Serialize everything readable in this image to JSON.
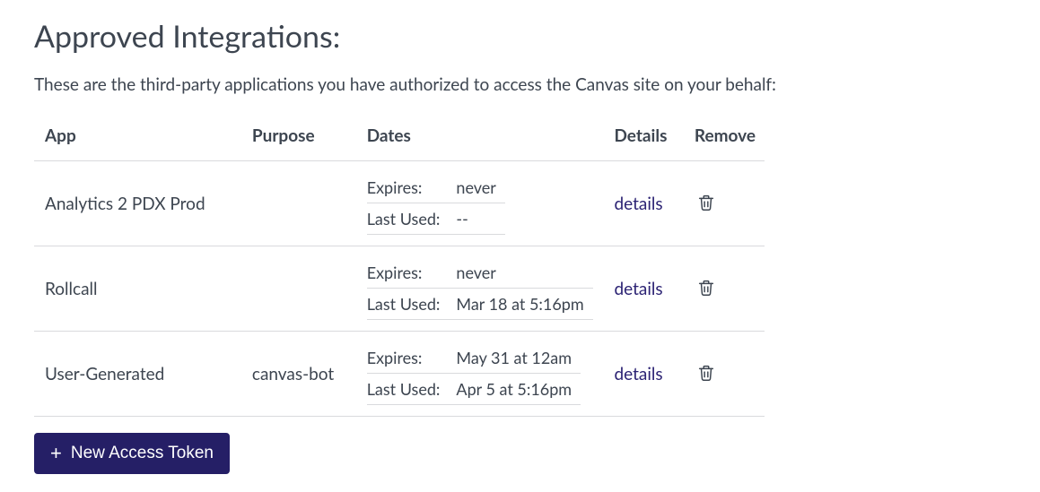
{
  "heading": "Approved Integrations:",
  "description": "These are the third-party applications you have authorized to access the Canvas site on your behalf:",
  "columns": {
    "app": "App",
    "purpose": "Purpose",
    "dates": "Dates",
    "details": "Details",
    "remove": "Remove"
  },
  "date_labels": {
    "expires": "Expires:",
    "last_used": "Last Used:"
  },
  "details_link_label": "details",
  "rows": [
    {
      "app": "Analytics 2 PDX Prod",
      "purpose": "",
      "expires": "never",
      "last_used": "--"
    },
    {
      "app": "Rollcall",
      "purpose": "",
      "expires": "never",
      "last_used": "Mar 18 at 5:16pm"
    },
    {
      "app": "User-Generated",
      "purpose": "canvas-bot",
      "expires": "May 31 at 12am",
      "last_used": "Apr 5 at 5:16pm"
    }
  ],
  "new_token_label": "New Access Token",
  "colors": {
    "accent": "#251f66"
  }
}
